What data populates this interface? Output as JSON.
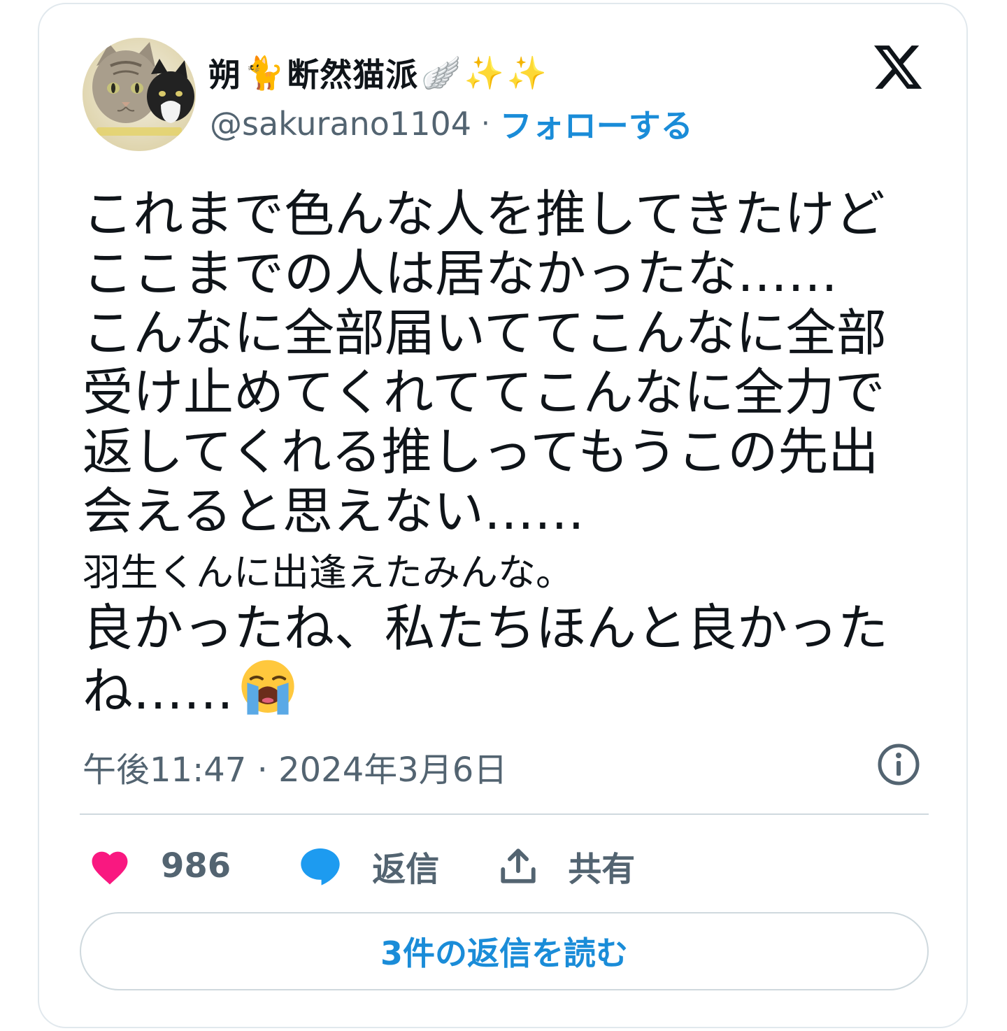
{
  "author": {
    "display_name": "朔",
    "display_name_main": "断然猫派",
    "name_emojis": [
      "🐈",
      "🪽",
      "✨",
      "✨"
    ],
    "handle": "@sakurano1104",
    "separator": "·",
    "follow_label": "フォローする",
    "avatar_icon": "cat-photo-avatar"
  },
  "brand_icon": "x-logo-icon",
  "tweet": {
    "text_main": "これまで色んな人を推してきたけどここまでの人は居なかったな……\nこんなに全部届いててこんなに全部受け止めてくれててこんなに全力で返してくれる推しってもうこの先出会えると思えない……",
    "text_small": "羽生くんに出逢えたみんな。",
    "text_tail": "良かったね、私たちほんと良かったね……",
    "tail_emoji": "loudly-crying-face"
  },
  "timestamp": "午後11:47 · 2024年3月6日",
  "actions": {
    "like_count": "986",
    "reply_label": "返信",
    "share_label": "共有"
  },
  "read_replies_label": "3件の返信を読む",
  "colors": {
    "accent_blue": "#1a8cd8",
    "like_pink": "#f91880",
    "reply_blue": "#1d9bf0",
    "secondary_text": "#536471",
    "border": "#cfd9de"
  }
}
